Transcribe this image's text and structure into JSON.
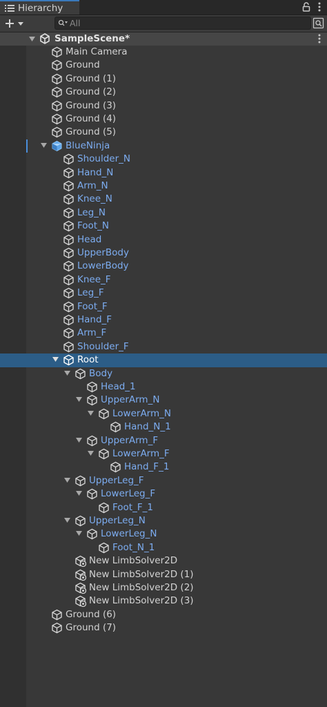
{
  "tab": {
    "title": "Hierarchy",
    "icon": "list-icon"
  },
  "toolbar": {
    "create_icon": "plus-icon",
    "search_placeholder": "All"
  },
  "scene": {
    "name": "SampleScene*"
  },
  "colors": {
    "selection": "#2c5d87",
    "prefab_text": "#7cacf0",
    "background": "#383838"
  },
  "tree": [
    {
      "label": "Main Camera",
      "depth": 0,
      "icon": "cube-icon",
      "color": "default"
    },
    {
      "label": "Ground",
      "depth": 0,
      "icon": "cube-icon",
      "color": "default"
    },
    {
      "label": "Ground (1)",
      "depth": 0,
      "icon": "cube-icon",
      "color": "default"
    },
    {
      "label": "Ground (2)",
      "depth": 0,
      "icon": "cube-icon",
      "color": "default"
    },
    {
      "label": "Ground (3)",
      "depth": 0,
      "icon": "cube-icon",
      "color": "default"
    },
    {
      "label": "Ground (4)",
      "depth": 0,
      "icon": "cube-icon",
      "color": "default"
    },
    {
      "label": "Ground (5)",
      "depth": 0,
      "icon": "cube-icon",
      "color": "default"
    },
    {
      "label": "BlueNinja",
      "depth": 0,
      "icon": "prefab-icon",
      "color": "blue",
      "expanded": true,
      "marker": true
    },
    {
      "label": "Shoulder_N",
      "depth": 1,
      "icon": "cube-icon",
      "color": "blue"
    },
    {
      "label": "Hand_N",
      "depth": 1,
      "icon": "cube-icon",
      "color": "blue"
    },
    {
      "label": "Arm_N",
      "depth": 1,
      "icon": "cube-icon",
      "color": "blue"
    },
    {
      "label": "Knee_N",
      "depth": 1,
      "icon": "cube-icon",
      "color": "blue"
    },
    {
      "label": "Leg_N",
      "depth": 1,
      "icon": "cube-icon",
      "color": "blue"
    },
    {
      "label": "Foot_N",
      "depth": 1,
      "icon": "cube-icon",
      "color": "blue"
    },
    {
      "label": "Head",
      "depth": 1,
      "icon": "cube-icon",
      "color": "blue"
    },
    {
      "label": "UpperBody",
      "depth": 1,
      "icon": "cube-icon",
      "color": "blue"
    },
    {
      "label": "LowerBody",
      "depth": 1,
      "icon": "cube-icon",
      "color": "blue"
    },
    {
      "label": "Knee_F",
      "depth": 1,
      "icon": "cube-icon",
      "color": "blue"
    },
    {
      "label": "Leg_F",
      "depth": 1,
      "icon": "cube-icon",
      "color": "blue"
    },
    {
      "label": "Foot_F",
      "depth": 1,
      "icon": "cube-icon",
      "color": "blue"
    },
    {
      "label": "Hand_F",
      "depth": 1,
      "icon": "cube-icon",
      "color": "blue"
    },
    {
      "label": "Arm_F",
      "depth": 1,
      "icon": "cube-icon",
      "color": "blue"
    },
    {
      "label": "Shoulder_F",
      "depth": 1,
      "icon": "cube-icon",
      "color": "blue"
    },
    {
      "label": "Root",
      "depth": 1,
      "icon": "cube-icon",
      "color": "white",
      "expanded": true,
      "selected": true
    },
    {
      "label": "Body",
      "depth": 2,
      "icon": "cube-icon",
      "color": "blue",
      "expanded": true
    },
    {
      "label": "Head_1",
      "depth": 3,
      "icon": "cube-icon",
      "color": "blue"
    },
    {
      "label": "UpperArm_N",
      "depth": 3,
      "icon": "cube-icon",
      "color": "blue",
      "expanded": true
    },
    {
      "label": "LowerArm_N",
      "depth": 4,
      "icon": "cube-icon",
      "color": "blue",
      "expanded": true
    },
    {
      "label": "Hand_N_1",
      "depth": 5,
      "icon": "cube-icon",
      "color": "blue"
    },
    {
      "label": "UpperArm_F",
      "depth": 3,
      "icon": "cube-icon",
      "color": "blue",
      "expanded": true
    },
    {
      "label": "LowerArm_F",
      "depth": 4,
      "icon": "cube-icon",
      "color": "blue",
      "expanded": true
    },
    {
      "label": "Hand_F_1",
      "depth": 5,
      "icon": "cube-icon",
      "color": "blue"
    },
    {
      "label": "UpperLeg_F",
      "depth": 2,
      "icon": "cube-icon",
      "color": "blue",
      "expanded": true
    },
    {
      "label": "LowerLeg_F",
      "depth": 3,
      "icon": "cube-icon",
      "color": "blue",
      "expanded": true
    },
    {
      "label": "Foot_F_1",
      "depth": 4,
      "icon": "cube-icon",
      "color": "blue"
    },
    {
      "label": "UpperLeg_N",
      "depth": 2,
      "icon": "cube-icon",
      "color": "blue",
      "expanded": true
    },
    {
      "label": "LowerLeg_N",
      "depth": 3,
      "icon": "cube-icon",
      "color": "blue",
      "expanded": true
    },
    {
      "label": "Foot_N_1",
      "depth": 4,
      "icon": "cube-icon",
      "color": "blue"
    },
    {
      "label": "New LimbSolver2D",
      "depth": 2,
      "icon": "solver-icon",
      "color": "default"
    },
    {
      "label": "New LimbSolver2D (1)",
      "depth": 2,
      "icon": "solver-icon",
      "color": "default"
    },
    {
      "label": "New LimbSolver2D (2)",
      "depth": 2,
      "icon": "solver-icon",
      "color": "default"
    },
    {
      "label": "New LimbSolver2D (3)",
      "depth": 2,
      "icon": "solver-icon",
      "color": "default"
    },
    {
      "label": "Ground (6)",
      "depth": 0,
      "icon": "cube-icon",
      "color": "default"
    },
    {
      "label": "Ground (7)",
      "depth": 0,
      "icon": "cube-icon",
      "color": "default"
    }
  ]
}
